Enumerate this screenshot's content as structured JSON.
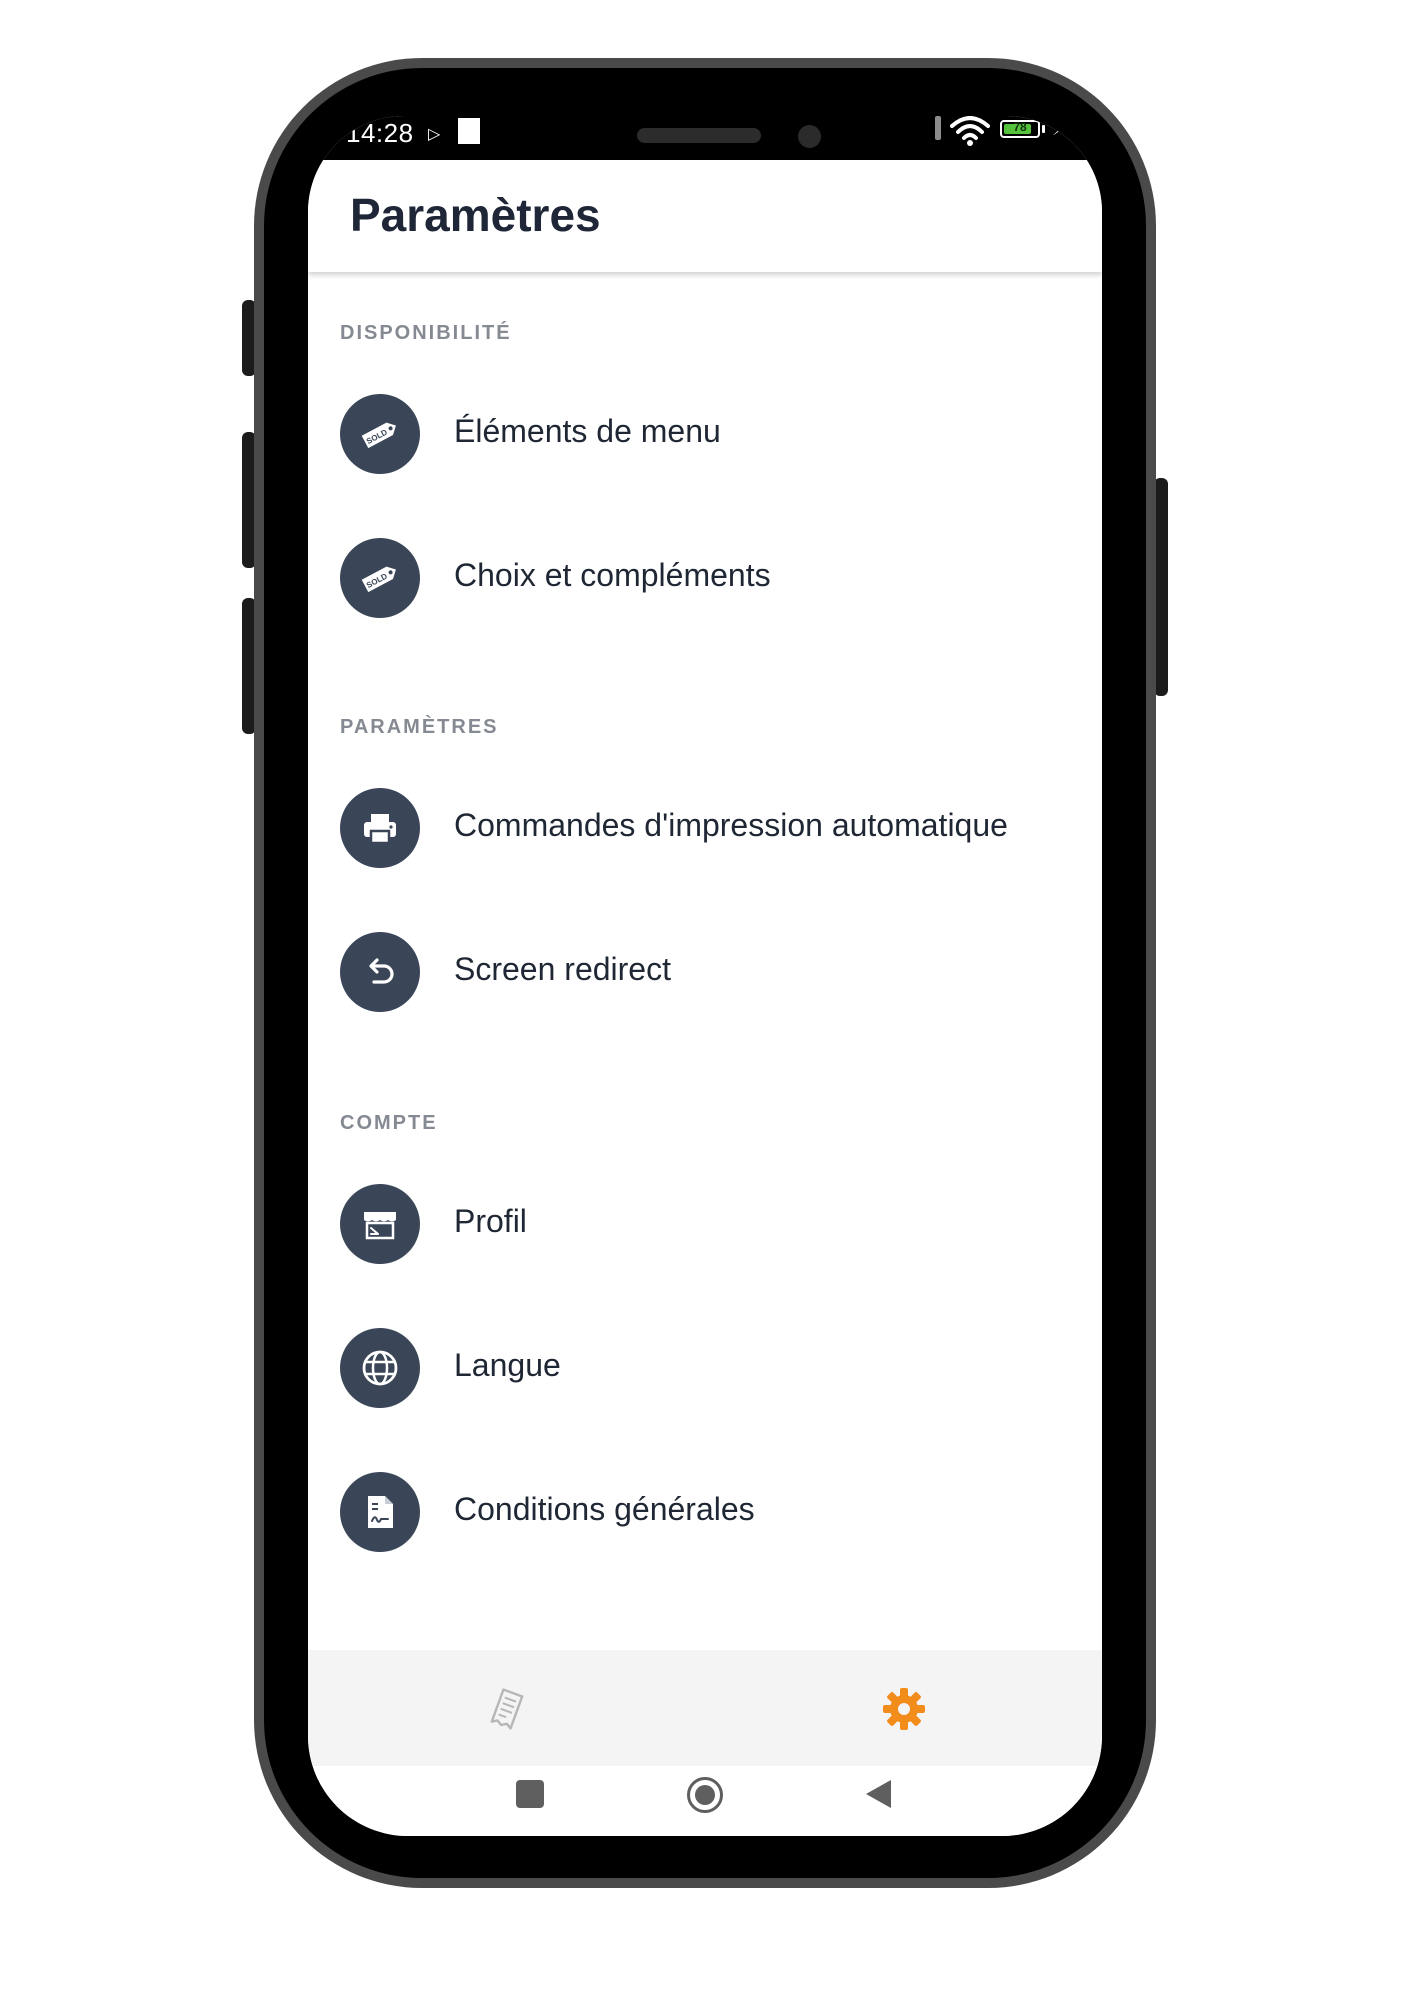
{
  "status_bar": {
    "time": "14:28",
    "battery_level": "78",
    "icons": [
      "play-icon",
      "notification-square-icon",
      "signal-icon",
      "wifi-icon",
      "battery-icon",
      "charging-bolt-icon"
    ]
  },
  "header": {
    "title": "Paramètres"
  },
  "sections": [
    {
      "title": "DISPONIBILITÉ",
      "items": [
        {
          "label": "Éléments de menu",
          "icon": "sold-tag-icon"
        },
        {
          "label": "Choix et compléments",
          "icon": "sold-tag-icon"
        }
      ]
    },
    {
      "title": "PARAMÈTRES",
      "items": [
        {
          "label": "Commandes d'impression automatique",
          "icon": "printer-icon"
        },
        {
          "label": "Screen redirect",
          "icon": "undo-arrow-icon"
        }
      ]
    },
    {
      "title": "COMPTE",
      "items": [
        {
          "label": "Profil",
          "icon": "storefront-icon"
        },
        {
          "label": "Langue",
          "icon": "globe-icon"
        },
        {
          "label": "Conditions générales",
          "icon": "document-signature-icon"
        }
      ]
    }
  ],
  "tab_bar": {
    "tabs": [
      {
        "icon": "receipt-orders-icon",
        "active": false
      },
      {
        "icon": "gear-icon",
        "active": true
      }
    ],
    "active_color": "#f28c1b",
    "inactive_color": "#b6b6b6"
  },
  "system_nav": {
    "buttons": [
      "recents-square-icon",
      "home-circle-icon",
      "back-triangle-icon"
    ]
  },
  "colors": {
    "icon_circle": "#3a4657",
    "title_text": "#1e2637",
    "section_text": "#858a92",
    "item_text": "#1f2734"
  }
}
